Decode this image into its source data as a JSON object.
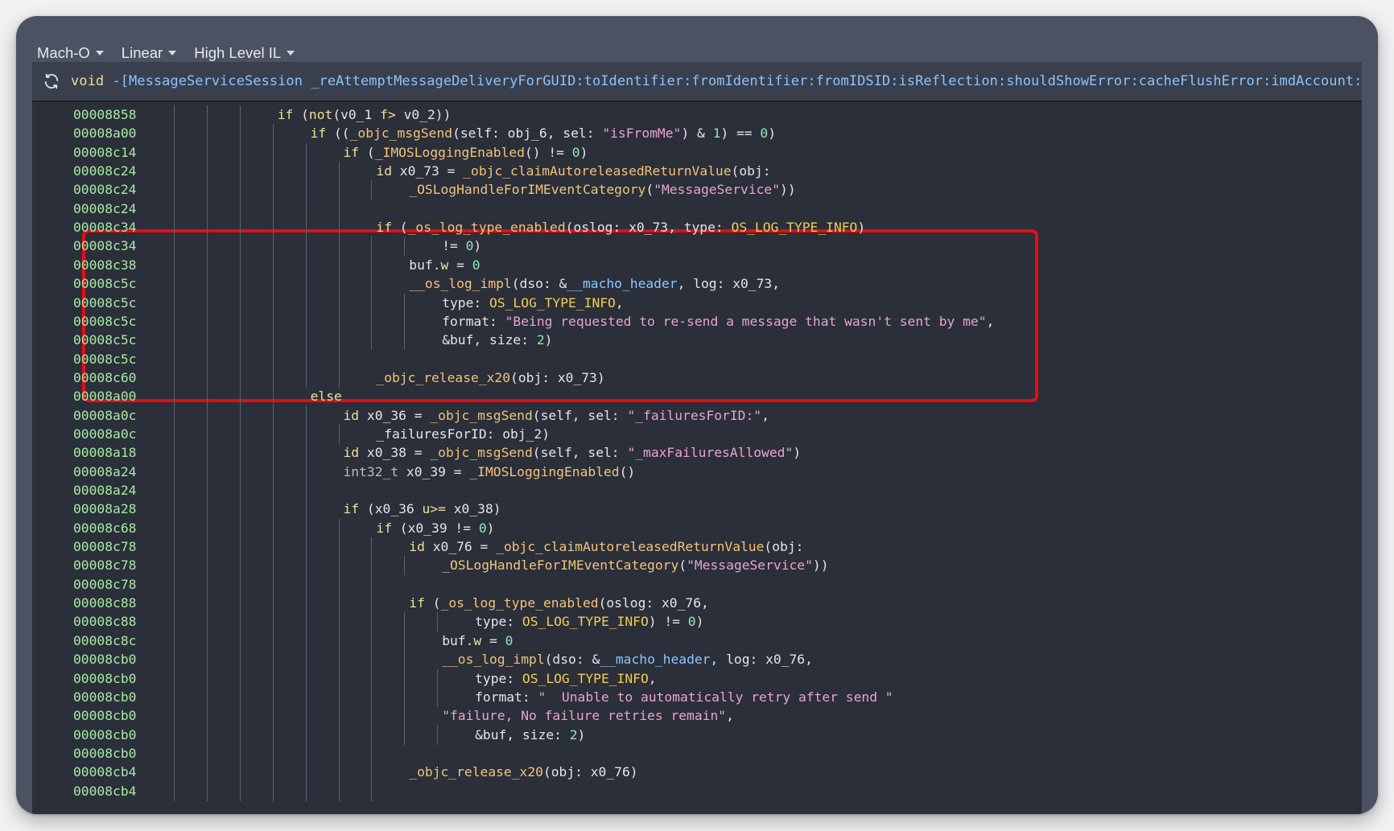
{
  "toolbar": {
    "view_type": "Mach-O",
    "layout": "Linear",
    "il_level": "High Level IL"
  },
  "header": {
    "return_type": "void",
    "signature": "-[MessageServiceSession _reAttemptMessageDeliveryForGUID:toIdentifier:fromIdentifier:fromIDSID:isReflection:shouldShowError:cacheFlushError:imdAccount:]"
  },
  "colors": {
    "highlight_border": "#e50d12",
    "address": "#a8e8a3",
    "keyword": "#ede09a",
    "function": "#f2c37a",
    "string": "#e9a3d0",
    "number": "#98e2b0",
    "constant": "#f3cc52"
  },
  "lines": [
    {
      "addr": "00008858",
      "indent": 7,
      "tokens": [
        [
          "kw",
          "if"
        ],
        [
          "txt",
          " ("
        ],
        [
          "kw",
          "not"
        ],
        [
          "txt",
          "(v0_1 "
        ],
        [
          "kw",
          "f>"
        ],
        [
          "txt",
          " v0_2))"
        ]
      ]
    },
    {
      "addr": "00008a00",
      "indent": 8,
      "tokens": [
        [
          "kw",
          "if"
        ],
        [
          "txt",
          " (("
        ],
        [
          "fn",
          "_objc_msgSend"
        ],
        [
          "txt",
          "(self: obj_6, sel: "
        ],
        [
          "str",
          "\"isFromMe\""
        ],
        [
          "txt",
          ") & "
        ],
        [
          "num",
          "1"
        ],
        [
          "txt",
          ") == "
        ],
        [
          "num",
          "0"
        ],
        [
          "txt",
          ")"
        ]
      ]
    },
    {
      "addr": "00008c14",
      "indent": 9,
      "tokens": [
        [
          "kw",
          "if"
        ],
        [
          "txt",
          " ("
        ],
        [
          "fn",
          "_IMOSLoggingEnabled"
        ],
        [
          "txt",
          "() != "
        ],
        [
          "num",
          "0"
        ],
        [
          "txt",
          ")"
        ]
      ]
    },
    {
      "addr": "00008c24",
      "indent": 10,
      "tokens": [
        [
          "kw",
          "id"
        ],
        [
          "txt",
          " x0_73 = "
        ],
        [
          "fn",
          "_objc_claimAutoreleasedReturnValue"
        ],
        [
          "txt",
          "(obj:"
        ]
      ]
    },
    {
      "addr": "00008c24",
      "indent": 11,
      "tokens": [
        [
          "fn",
          "_OSLogHandleForIMEventCategory"
        ],
        [
          "txt",
          "("
        ],
        [
          "str",
          "\"MessageService\""
        ],
        [
          "txt",
          "))"
        ]
      ]
    },
    {
      "addr": "00008c24",
      "indent": 10,
      "tokens": []
    },
    {
      "addr": "00008c34",
      "indent": 10,
      "tokens": [
        [
          "kw",
          "if"
        ],
        [
          "txt",
          " ("
        ],
        [
          "fn",
          "_os_log_type_enabled"
        ],
        [
          "txt",
          "(oslog: x0_73, type: "
        ],
        [
          "const",
          "OS_LOG_TYPE_INFO"
        ],
        [
          "txt",
          ")"
        ]
      ]
    },
    {
      "addr": "00008c34",
      "indent": 12,
      "tokens": [
        [
          "txt",
          "!= "
        ],
        [
          "num",
          "0"
        ],
        [
          "txt",
          ")"
        ]
      ]
    },
    {
      "addr": "00008c38",
      "indent": 11,
      "tokens": [
        [
          "txt",
          "buf"
        ],
        [
          "kw",
          ".w"
        ],
        [
          "txt",
          " = "
        ],
        [
          "num",
          "0"
        ]
      ]
    },
    {
      "addr": "00008c5c",
      "indent": 11,
      "tokens": [
        [
          "fn",
          "__os_log_impl"
        ],
        [
          "txt",
          "(dso: &"
        ],
        [
          "sym",
          "__macho_header"
        ],
        [
          "txt",
          ", log: x0_73,"
        ]
      ]
    },
    {
      "addr": "00008c5c",
      "indent": 12,
      "tokens": [
        [
          "txt",
          "type: "
        ],
        [
          "const",
          "OS_LOG_TYPE_INFO"
        ],
        [
          "txt",
          ","
        ]
      ]
    },
    {
      "addr": "00008c5c",
      "indent": 12,
      "tokens": [
        [
          "txt",
          "format: "
        ],
        [
          "str",
          "\"Being requested to re-send a message that wasn't sent by me\""
        ],
        [
          "txt",
          ","
        ]
      ]
    },
    {
      "addr": "00008c5c",
      "indent": 12,
      "tokens": [
        [
          "txt",
          "&buf, size: "
        ],
        [
          "num",
          "2"
        ],
        [
          "txt",
          ")"
        ]
      ]
    },
    {
      "addr": "00008c5c",
      "indent": 10,
      "tokens": []
    },
    {
      "addr": "00008c60",
      "indent": 10,
      "tokens": [
        [
          "fn",
          "_objc_release_x20"
        ],
        [
          "txt",
          "(obj: x0_73)"
        ]
      ]
    },
    {
      "addr": "00008a00",
      "indent": 8,
      "tokens": [
        [
          "kw",
          "else"
        ]
      ]
    },
    {
      "addr": "00008a0c",
      "indent": 9,
      "tokens": [
        [
          "kw",
          "id"
        ],
        [
          "txt",
          " x0_36 = "
        ],
        [
          "fn",
          "_objc_msgSend"
        ],
        [
          "txt",
          "(self, sel: "
        ],
        [
          "str",
          "\"_failuresForID:\""
        ],
        [
          "txt",
          ","
        ]
      ]
    },
    {
      "addr": "00008a0c",
      "indent": 10,
      "tokens": [
        [
          "txt",
          "_failuresForID: obj_2)"
        ]
      ]
    },
    {
      "addr": "00008a18",
      "indent": 9,
      "tokens": [
        [
          "kw",
          "id"
        ],
        [
          "txt",
          " x0_38 = "
        ],
        [
          "fn",
          "_objc_msgSend"
        ],
        [
          "txt",
          "(self, sel: "
        ],
        [
          "str",
          "\"_maxFailuresAllowed\""
        ],
        [
          "txt",
          ")"
        ]
      ]
    },
    {
      "addr": "00008a24",
      "indent": 9,
      "tokens": [
        [
          "type",
          "int32_t"
        ],
        [
          "txt",
          " x0_39 = "
        ],
        [
          "fn",
          "_IMOSLoggingEnabled"
        ],
        [
          "txt",
          "()"
        ]
      ]
    },
    {
      "addr": "00008a24",
      "indent": 9,
      "tokens": []
    },
    {
      "addr": "00008a28",
      "indent": 9,
      "tokens": [
        [
          "kw",
          "if"
        ],
        [
          "txt",
          " (x0_36 "
        ],
        [
          "kw",
          "u>="
        ],
        [
          "txt",
          " x0_38)"
        ]
      ]
    },
    {
      "addr": "00008c68",
      "indent": 10,
      "tokens": [
        [
          "kw",
          "if"
        ],
        [
          "txt",
          " (x0_39 != "
        ],
        [
          "num",
          "0"
        ],
        [
          "txt",
          ")"
        ]
      ]
    },
    {
      "addr": "00008c78",
      "indent": 11,
      "tokens": [
        [
          "kw",
          "id"
        ],
        [
          "txt",
          " x0_76 = "
        ],
        [
          "fn",
          "_objc_claimAutoreleasedReturnValue"
        ],
        [
          "txt",
          "(obj:"
        ]
      ]
    },
    {
      "addr": "00008c78",
      "indent": 12,
      "tokens": [
        [
          "fn",
          "_OSLogHandleForIMEventCategory"
        ],
        [
          "txt",
          "("
        ],
        [
          "str",
          "\"MessageService\""
        ],
        [
          "txt",
          "))"
        ]
      ]
    },
    {
      "addr": "00008c78",
      "indent": 11,
      "tokens": []
    },
    {
      "addr": "00008c88",
      "indent": 11,
      "tokens": [
        [
          "kw",
          "if"
        ],
        [
          "txt",
          " ("
        ],
        [
          "fn",
          "_os_log_type_enabled"
        ],
        [
          "txt",
          "(oslog: x0_76,"
        ]
      ]
    },
    {
      "addr": "00008c88",
      "indent": 13,
      "tokens": [
        [
          "txt",
          "type: "
        ],
        [
          "const",
          "OS_LOG_TYPE_INFO"
        ],
        [
          "txt",
          ") != "
        ],
        [
          "num",
          "0"
        ],
        [
          "txt",
          ")"
        ]
      ]
    },
    {
      "addr": "00008c8c",
      "indent": 12,
      "tokens": [
        [
          "txt",
          "buf"
        ],
        [
          "kw",
          ".w"
        ],
        [
          "txt",
          " = "
        ],
        [
          "num",
          "0"
        ]
      ]
    },
    {
      "addr": "00008cb0",
      "indent": 12,
      "tokens": [
        [
          "fn",
          "__os_log_impl"
        ],
        [
          "txt",
          "(dso: &"
        ],
        [
          "sym",
          "__macho_header"
        ],
        [
          "txt",
          ", log: x0_76,"
        ]
      ]
    },
    {
      "addr": "00008cb0",
      "indent": 13,
      "tokens": [
        [
          "txt",
          "type: "
        ],
        [
          "const",
          "OS_LOG_TYPE_INFO"
        ],
        [
          "txt",
          ","
        ]
      ]
    },
    {
      "addr": "00008cb0",
      "indent": 13,
      "tokens": [
        [
          "txt",
          "format: "
        ],
        [
          "str",
          "\"  Unable to automatically retry after send \""
        ]
      ]
    },
    {
      "addr": "00008cb0",
      "indent": 12,
      "tokens": [
        [
          "str",
          "\"failure, No failure retries remain\""
        ],
        [
          "txt",
          ","
        ]
      ]
    },
    {
      "addr": "00008cb0",
      "indent": 13,
      "tokens": [
        [
          "txt",
          "&buf, size: "
        ],
        [
          "num",
          "2"
        ],
        [
          "txt",
          ")"
        ]
      ]
    },
    {
      "addr": "00008cb0",
      "indent": 11,
      "tokens": []
    },
    {
      "addr": "00008cb4",
      "indent": 11,
      "tokens": [
        [
          "fn",
          "_objc_release_x20"
        ],
        [
          "txt",
          "(obj: x0_76)"
        ]
      ]
    },
    {
      "addr": "00008cb4",
      "indent": 11,
      "tokens": []
    }
  ]
}
